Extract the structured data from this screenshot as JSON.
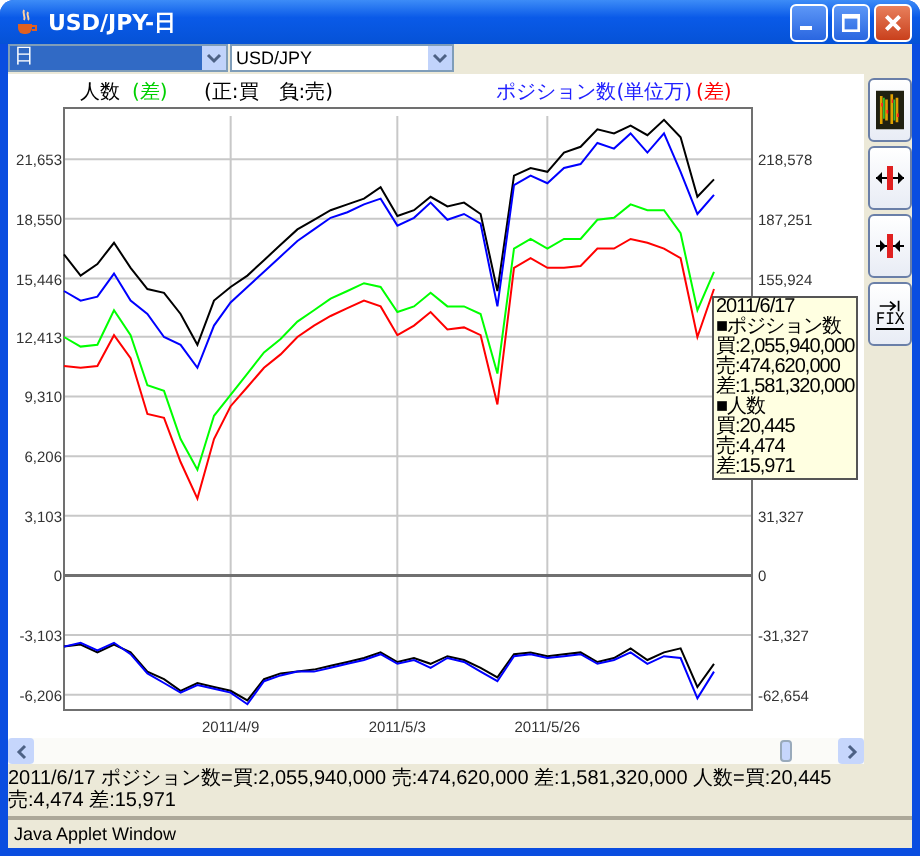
{
  "window": {
    "title": "USD/JPY-日"
  },
  "toolbar": {
    "period": {
      "value": "日"
    },
    "pair": {
      "value": "USD/JPY"
    }
  },
  "chart": {
    "legend_left": {
      "label": "人数",
      "tag": "(差)",
      "color": "#00d000"
    },
    "note": "(正:買　負:売)",
    "legend_right": {
      "label": "ポジション数(単位万)",
      "tag": "(差)",
      "color": "#ff0000"
    },
    "right_axis_labels_upper": [
      "218,578",
      "187,251",
      "155,924"
    ],
    "right_axis_labels_lower": [
      "31,327",
      "0",
      "-31,327",
      "-62,654"
    ],
    "tooltip": [
      "2011/6/17",
      "■ポジション数",
      "買:2,055,940,000",
      "売:474,620,000",
      "差:1,581,320,000",
      "■人数",
      "買:20,445",
      "売:4,474",
      "差:15,971"
    ],
    "chart_data": {
      "type": "line",
      "grid": true,
      "ylim": [
        -7000,
        23900
      ],
      "categories": [
        null,
        null,
        null,
        null,
        null,
        null,
        null,
        null,
        null,
        null,
        "2011/4/9",
        null,
        null,
        null,
        null,
        null,
        null,
        null,
        null,
        null,
        "2011/5/3",
        null,
        null,
        null,
        null,
        null,
        null,
        null,
        null,
        "2011/5/26",
        null,
        null,
        null,
        null,
        null,
        null,
        null,
        null,
        null,
        null
      ],
      "yticks": [
        {
          "value": 21653,
          "label": "21,653"
        },
        {
          "value": 18550,
          "label": "18,550"
        },
        {
          "value": 15446,
          "label": "15,446"
        },
        {
          "value": 12413,
          "label": "12,413"
        },
        {
          "value": 9310,
          "label": "9,310"
        },
        {
          "value": 6206,
          "label": "6,206"
        },
        {
          "value": 3103,
          "label": "3,103"
        },
        {
          "value": 0,
          "label": "0"
        },
        {
          "value": -3103,
          "label": "-3,103"
        },
        {
          "value": -6206,
          "label": "-6,206"
        }
      ],
      "series": [
        {
          "color": "#000000",
          "values": [
            16700,
            15600,
            16200,
            17300,
            16000,
            14900,
            14700,
            13600,
            12000,
            14300,
            15000,
            15600,
            16400,
            17200,
            18000,
            18500,
            19000,
            19300,
            19600,
            20200,
            18700,
            19000,
            19700,
            19200,
            19400,
            18800,
            14800,
            20800,
            21200,
            21000,
            22000,
            22300,
            23200,
            23000,
            23400,
            22900,
            23700,
            22800,
            19700,
            20600
          ]
        },
        {
          "color": "#0000ff",
          "values": [
            14800,
            14300,
            14500,
            15700,
            14300,
            13600,
            12400,
            12000,
            10800,
            13000,
            14200,
            15000,
            15800,
            16600,
            17400,
            18000,
            18600,
            18900,
            19300,
            19600,
            18200,
            18600,
            19400,
            18500,
            18800,
            18300,
            14000,
            20300,
            20800,
            20400,
            21200,
            21400,
            22500,
            22200,
            23000,
            22000,
            23000,
            21000,
            18800,
            19800
          ]
        },
        {
          "color": "#00ff00",
          "values": [
            12400,
            11900,
            12000,
            13800,
            12500,
            9900,
            9600,
            7100,
            5500,
            8300,
            9400,
            10500,
            11600,
            12300,
            13200,
            13800,
            14400,
            14800,
            15200,
            15000,
            13700,
            14000,
            14700,
            14000,
            14000,
            13600,
            10500,
            17000,
            17500,
            17000,
            17500,
            17500,
            18500,
            18600,
            19300,
            19000,
            19000,
            17800,
            13800,
            15800
          ]
        },
        {
          "color": "#ff0000",
          "values": [
            10900,
            10800,
            10900,
            12500,
            11300,
            8400,
            8200,
            5900,
            4000,
            7100,
            8800,
            9800,
            10800,
            11500,
            12400,
            13000,
            13500,
            13900,
            14300,
            14000,
            12500,
            13000,
            13700,
            12800,
            12900,
            12500,
            8900,
            16000,
            16500,
            16000,
            16000,
            16100,
            17000,
            17000,
            17500,
            17300,
            17000,
            16500,
            12400,
            14900
          ]
        },
        {
          "color": "#000000",
          "values": [
            -3700,
            -3600,
            -4000,
            -3600,
            -4000,
            -5000,
            -5400,
            -6000,
            -5600,
            -5800,
            -6000,
            -6500,
            -5400,
            -5100,
            -5000,
            -4900,
            -4700,
            -4500,
            -4300,
            -4000,
            -4500,
            -4300,
            -4600,
            -4200,
            -4400,
            -4800,
            -5300,
            -4100,
            -4000,
            -4200,
            -4100,
            -4000,
            -4500,
            -4300,
            -3800,
            -4400,
            -4000,
            -3800,
            -5800,
            -4600
          ]
        },
        {
          "color": "#0000ff",
          "values": [
            -3700,
            -3500,
            -3900,
            -3500,
            -4100,
            -5100,
            -5600,
            -6100,
            -5700,
            -5900,
            -6100,
            -6700,
            -5500,
            -5200,
            -5000,
            -5000,
            -4800,
            -4600,
            -4400,
            -4100,
            -4600,
            -4400,
            -4800,
            -4300,
            -4500,
            -5000,
            -5500,
            -4200,
            -4100,
            -4300,
            -4200,
            -4100,
            -4600,
            -4400,
            -4000,
            -4600,
            -4200,
            -4300,
            -6400,
            -5000
          ]
        }
      ]
    }
  },
  "sidebar": {
    "buttons": [
      {
        "kind": "chart"
      },
      {
        "kind": "expand"
      },
      {
        "kind": "shrink"
      },
      {
        "kind": "fix",
        "label": "FIX"
      }
    ]
  },
  "status": "2011/6/17  ポジション数=買:2,055,940,000 売:474,620,000 差:1,581,320,000 人数=買:20,445 売:4,474 差:15,971",
  "footer": "Java Applet Window"
}
